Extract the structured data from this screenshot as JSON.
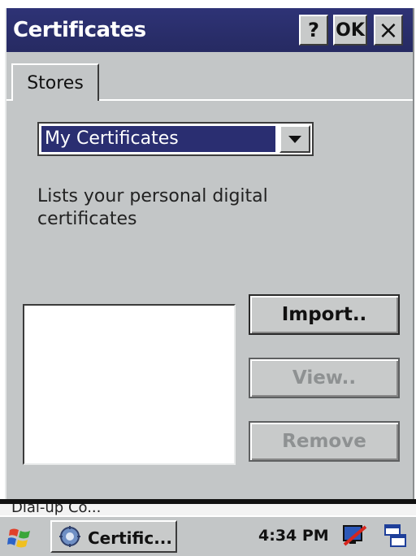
{
  "window": {
    "title": "Certificates",
    "help_label": "?",
    "ok_label": "OK",
    "close_label": "×"
  },
  "tabs": [
    {
      "label": "Stores"
    }
  ],
  "store_select": {
    "selected": "My Certificates"
  },
  "description": "Lists your personal digital certificates",
  "buttons": {
    "import_label": "Import..",
    "view_label": "View..",
    "remove_label": "Remove"
  },
  "background_peek": "Dial-up Co...",
  "taskbar": {
    "task_label": "Certific...",
    "clock": "4:34 PM"
  },
  "colors": {
    "title_bar": "#2a2e6e",
    "selection": "#2a2e71",
    "face": "#c3c6c7",
    "disabled_text": "#8e9192"
  },
  "icons": [
    "help-icon",
    "close-icon",
    "dropdown-arrow-icon",
    "start-logo-icon",
    "certificate-task-icon",
    "network-icon",
    "windows-icon"
  ]
}
